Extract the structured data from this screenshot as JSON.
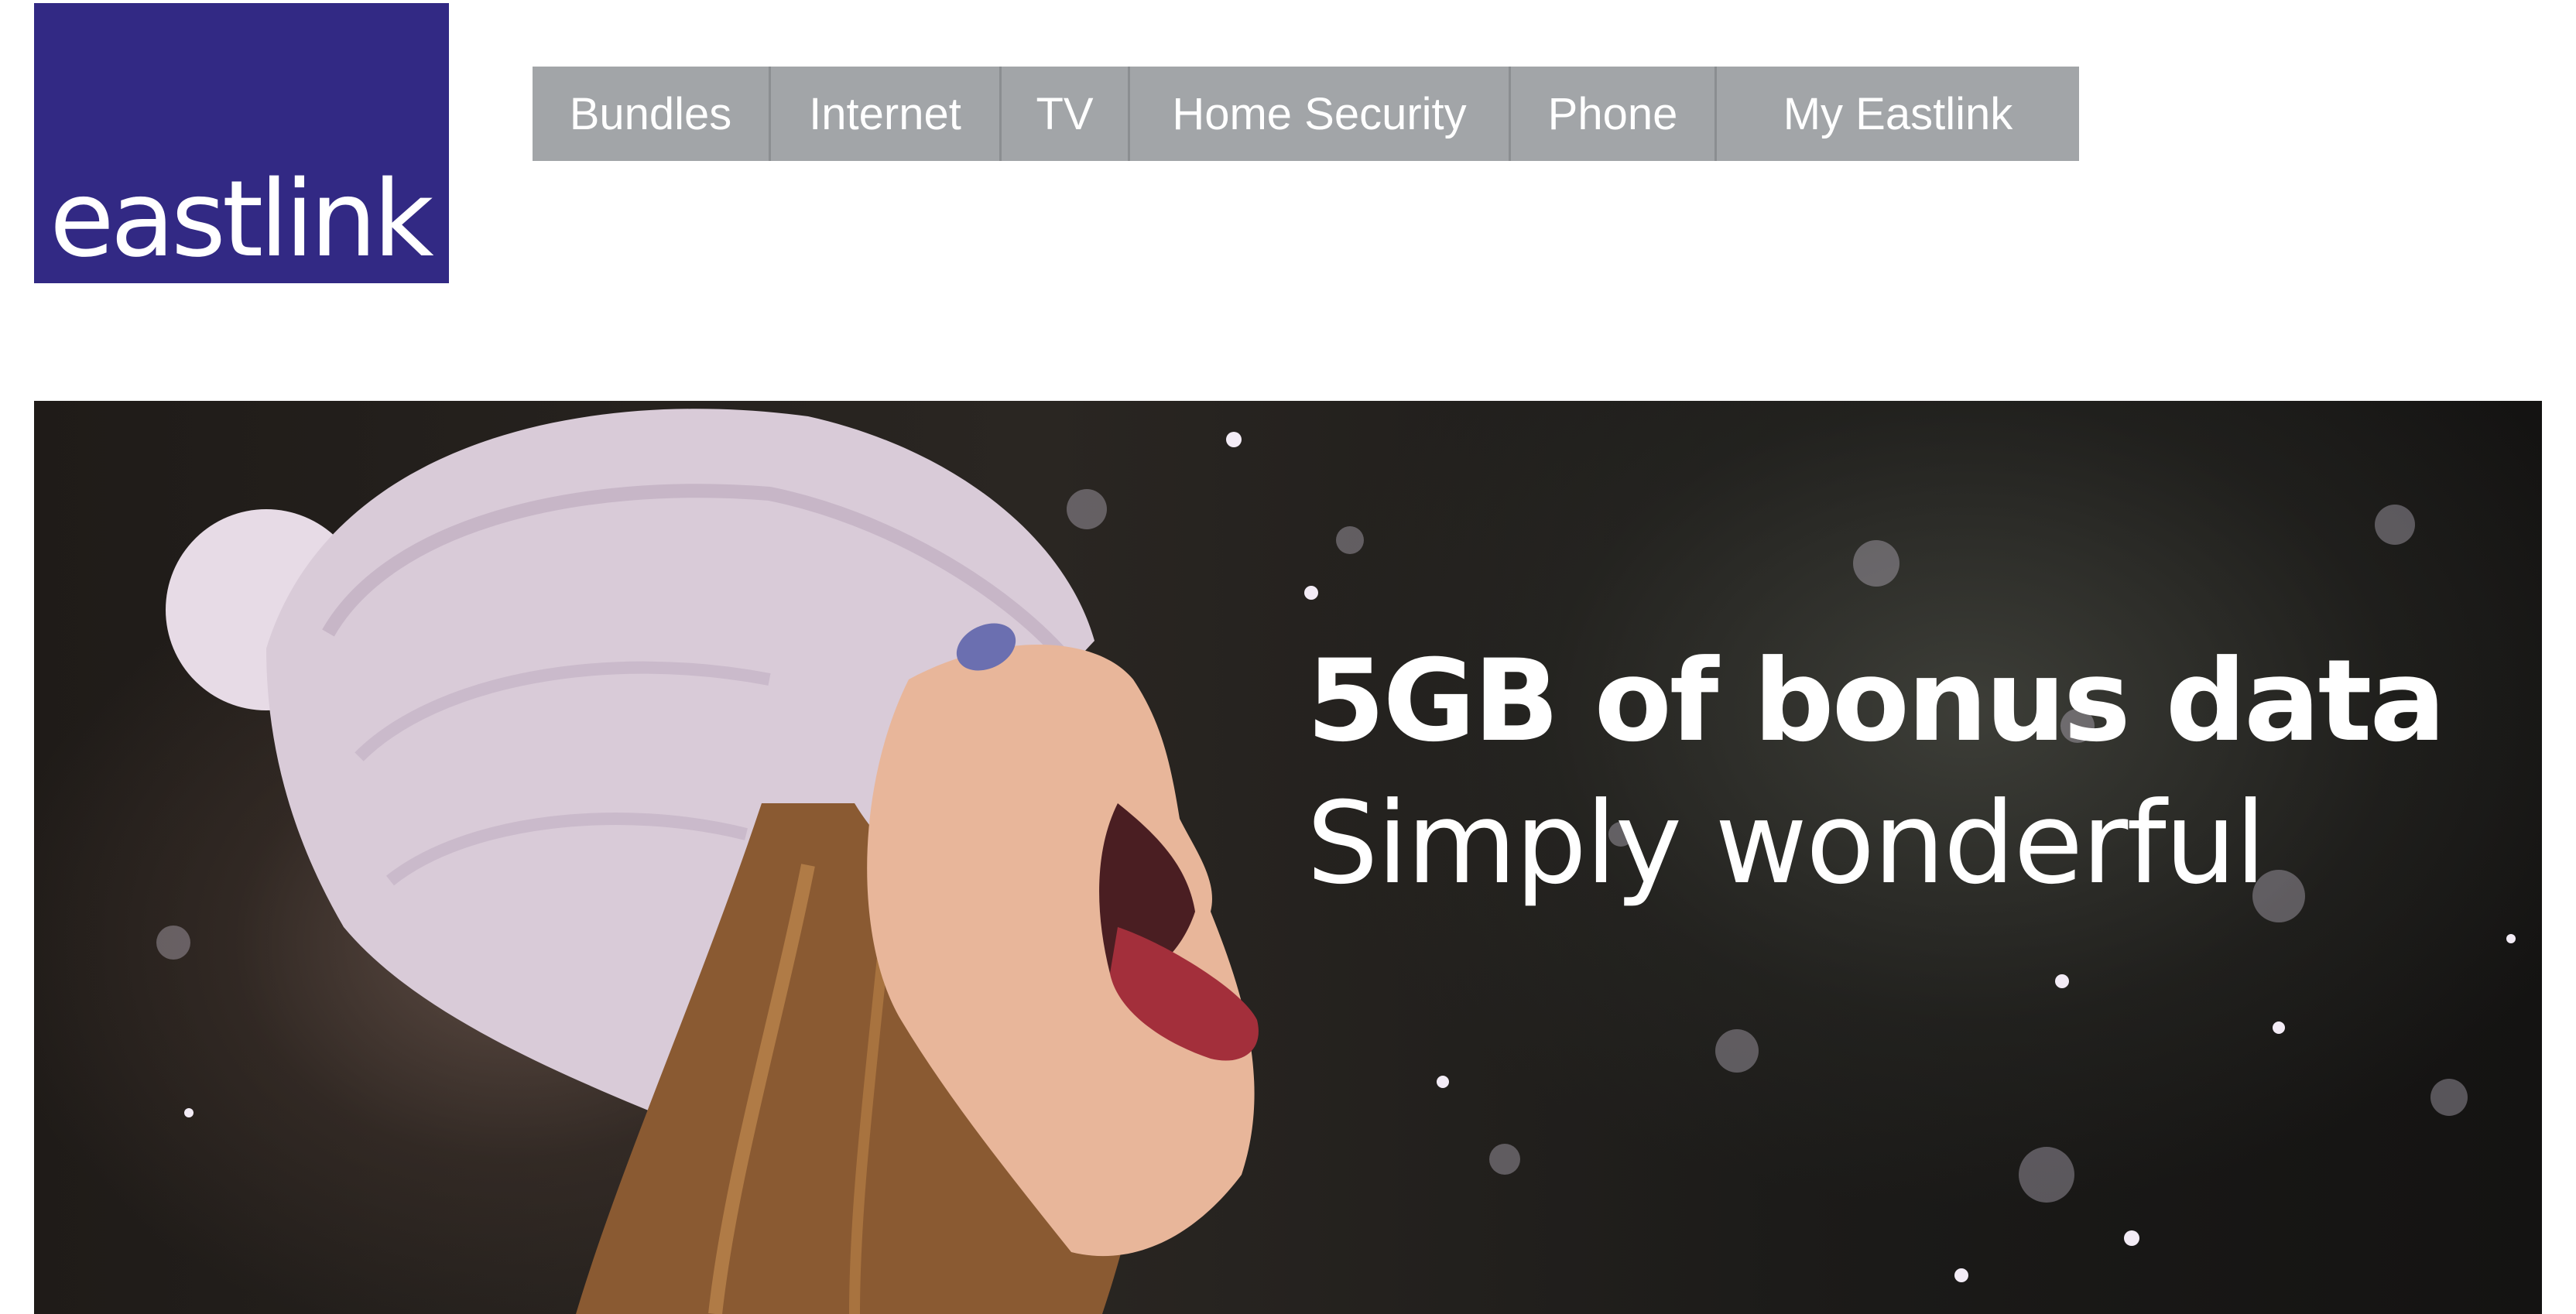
{
  "brand": {
    "logo_text": "eastlink",
    "color": "#322984"
  },
  "nav": {
    "items": [
      {
        "label": "Bundles"
      },
      {
        "label": "Internet"
      },
      {
        "label": "TV"
      },
      {
        "label": "Home Security"
      },
      {
        "label": "Phone"
      },
      {
        "label": "My Eastlink"
      }
    ],
    "background": "#a2a5a8"
  },
  "hero": {
    "headline": "5GB of bonus data",
    "subheadline": "Simply wonderful"
  }
}
